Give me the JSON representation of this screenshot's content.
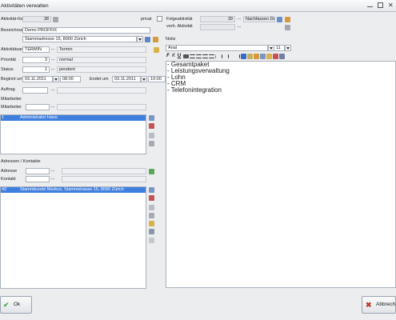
{
  "window": {
    "title": "Aktivitäten verwalten"
  },
  "form": {
    "activity_for": {
      "label": "Aktivität-für",
      "value": "38"
    },
    "private": {
      "label": "privat"
    },
    "follow_up": {
      "label": "Folgeaktivität",
      "value": "39",
      "text": "Nachfassen Den"
    },
    "previous": {
      "label": "vorh. Aktivität"
    },
    "description": {
      "label": "Bezeichnung",
      "value": "Demo PROFFIX"
    },
    "address": {
      "value": "Stammadresse 15, 8000 Zürich"
    },
    "activity_type": {
      "label": "Aktivitätsart",
      "code": "TERMIN",
      "text": "Termin"
    },
    "priority": {
      "label": "Priorität",
      "code": "3",
      "text": "normal"
    },
    "status": {
      "label": "Status",
      "code": "1",
      "text": "pendent"
    },
    "begin": {
      "label": "Beginnt um",
      "date": "03.11.2011",
      "time": "08:00"
    },
    "end": {
      "label": "Endet um",
      "date": "03.11.2011",
      "time": "10:00"
    },
    "order": {
      "label": "Auftrag"
    },
    "employees_header": "Mitarbeiter",
    "employee": {
      "label": "Mitarbeiter"
    },
    "employees": [
      {
        "id": "1",
        "name": "Administrator Hans"
      }
    ],
    "addresses_header": "Adressen / Kontakte",
    "address_field": {
      "label": "Adresse"
    },
    "contact_field": {
      "label": "Kontakt"
    },
    "addresses": [
      {
        "id": "42",
        "name": "Stammkunde Markus, Stammstrasse 15, 8000 Zürich"
      }
    ]
  },
  "note": {
    "label": "Notiz",
    "font": "Arial",
    "size": "11",
    "toolbar": [
      "F",
      "K",
      "U"
    ],
    "lines": [
      "- Gesamtpaket",
      "- Leistungsverwaltung",
      "- Lohn",
      "- CRM",
      "- Telefonintegration"
    ]
  },
  "buttons": {
    "ok": "Ok",
    "cancel": "Abbrechen"
  },
  "colors": {
    "selection": "#3f7fe0",
    "window_bg": "#ecedef"
  }
}
